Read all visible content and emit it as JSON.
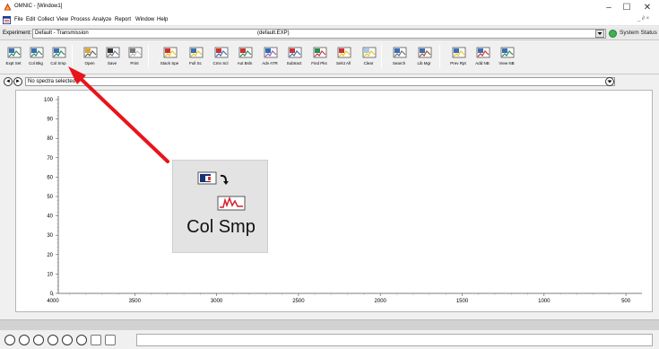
{
  "window": {
    "title": "OMNIC - [Window1]",
    "minimize_glyph": "–",
    "maximize_glyph": "☐",
    "close_glyph": "✕"
  },
  "menu": {
    "items": [
      "File",
      "Edit",
      "Collect",
      "View",
      "Process",
      "Analyze",
      "Report",
      "Window",
      "Help"
    ],
    "mdi_controls": "_ ∂ ×"
  },
  "experiment": {
    "label": "Experiment:",
    "value": "Default - Transmission",
    "file": "(default.EXP)",
    "system_status": "System Status"
  },
  "toolbar": {
    "buttons": [
      {
        "label": "Expt Set",
        "icon": "expt-set-icon"
      },
      {
        "label": "Col Bkg",
        "icon": "collect-background-icon"
      },
      {
        "label": "Col Smp",
        "icon": "collect-sample-icon"
      },
      {
        "label": "Open",
        "icon": "open-folder-icon"
      },
      {
        "label": "Save",
        "icon": "save-disk-icon"
      },
      {
        "label": "Print",
        "icon": "printer-icon"
      },
      {
        "label": "Stack Spe",
        "icon": "stack-spectra-icon"
      },
      {
        "label": "Full Sc",
        "icon": "full-scale-icon"
      },
      {
        "label": "Cmn Scl",
        "icon": "common-scale-icon"
      },
      {
        "label": "Aut Bsln",
        "icon": "auto-baseline-icon"
      },
      {
        "label": "Adv ATR",
        "icon": "advanced-atr-icon"
      },
      {
        "label": "Subtract",
        "icon": "subtract-icon"
      },
      {
        "label": "Find Pks",
        "icon": "find-peaks-icon"
      },
      {
        "label": "Selct All",
        "icon": "select-all-icon"
      },
      {
        "label": "Clear",
        "icon": "clear-icon"
      },
      {
        "label": "Search",
        "icon": "search-icon"
      },
      {
        "label": "Lib Mgr",
        "icon": "library-manager-icon"
      },
      {
        "label": "Prev Rpt",
        "icon": "preview-report-icon"
      },
      {
        "label": "Add NB",
        "icon": "add-notebook-icon"
      },
      {
        "label": "View NB",
        "icon": "view-notebook-icon"
      }
    ]
  },
  "spectra": {
    "status": "No spectra selected",
    "prev_glyph": "◄",
    "next_glyph": "►"
  },
  "plot": {
    "y_ticks": [
      "100",
      "90",
      "80",
      "70",
      "60",
      "50",
      "40",
      "30",
      "20",
      "10",
      "0"
    ],
    "x_ticks": [
      "4000",
      "3500",
      "3000",
      "2500",
      "2000",
      "1500",
      "1000",
      "500"
    ]
  },
  "callout": {
    "label": "Col Smp",
    "icon": "collect-sample-icon"
  },
  "annotation": {
    "arrow_color": "#e8141a"
  },
  "bottom_tools": [
    "pointer-tool-icon",
    "region-tool-icon",
    "peak-height-tool-icon",
    "peak-area-tool-icon",
    "spectral-info-tool-icon",
    "text-tool-icon",
    "pan-zoom-tool-icon",
    "tools-menu-icon"
  ]
}
